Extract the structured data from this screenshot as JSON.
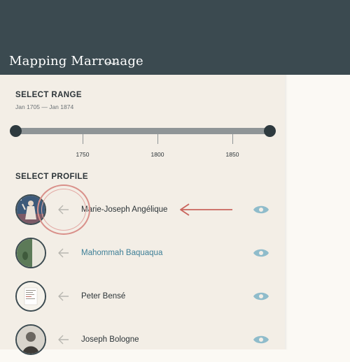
{
  "header": {
    "title": "Mapping Marronage"
  },
  "range": {
    "heading": "SELECT RANGE",
    "subtitle": "Jan 1705 — Jan 1874",
    "ticks": [
      "1750",
      "1800",
      "1850"
    ]
  },
  "profiles": {
    "heading": "SELECT PROFILE",
    "items": [
      {
        "name": "Marie-Joseph Angélique",
        "avatar": "portrait-illustration"
      },
      {
        "name": "Mahommah Baquaqua",
        "avatar": "book-cover",
        "highlighted": true
      },
      {
        "name": "Peter Bensé",
        "avatar": "document-page"
      },
      {
        "name": "Joseph Bologne",
        "avatar": "engraved-portrait"
      }
    ]
  },
  "colors": {
    "header_bg": "#3b4a50",
    "panel_bg": "#f3eee6",
    "accent_teal": "#3e7f97",
    "eye_icon": "#8fbccb",
    "annotation_red": "#c9645c"
  }
}
